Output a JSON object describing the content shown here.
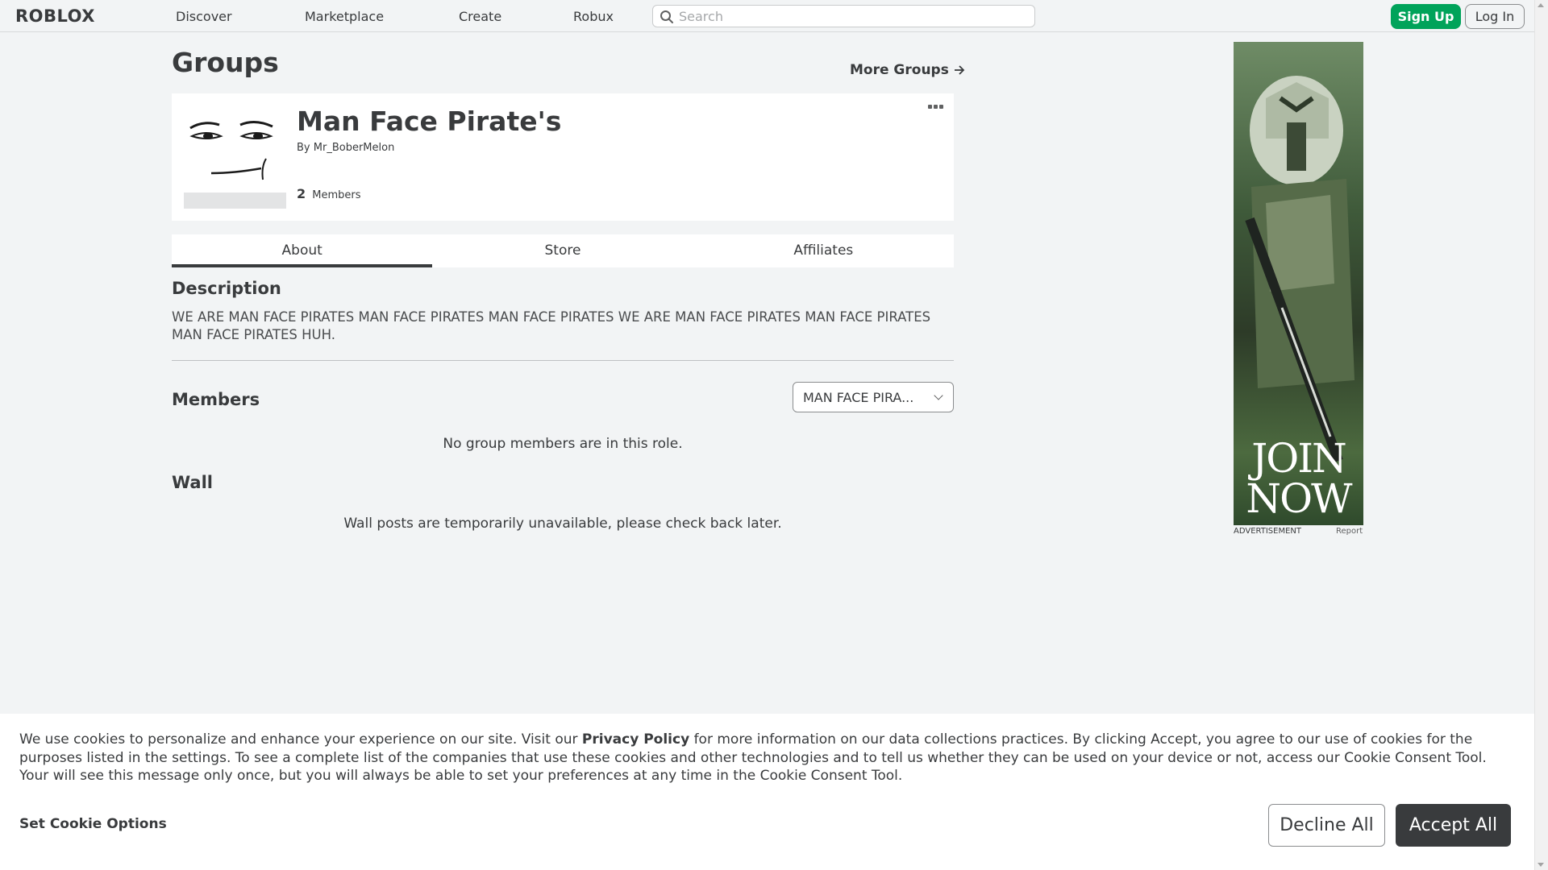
{
  "nav": {
    "logo": "ROBLOX",
    "links": [
      "Discover",
      "Marketplace",
      "Create",
      "Robux"
    ],
    "search_placeholder": "Search",
    "signup": "Sign Up",
    "login": "Log In"
  },
  "page": {
    "title": "Groups",
    "more_groups": "More Groups"
  },
  "group": {
    "name": "Man Face Pirate's",
    "by_prefix": "By",
    "owner": "Mr_BoberMelon",
    "member_count": "2",
    "members_label": "Members"
  },
  "tabs": [
    "About",
    "Store",
    "Affiliates"
  ],
  "about": {
    "description_heading": "Description",
    "description": "WE ARE MAN FACE PIRATES MAN FACE PIRATES MAN FACE PIRATES WE ARE MAN FACE PIRATES MAN FACE PIRATES MAN FACE PIRATES HUH.",
    "members_heading": "Members",
    "role_selected": "MAN FACE PIRA...",
    "no_members": "No group members are in this role.",
    "wall_heading": "Wall",
    "wall_unavailable": "Wall posts are temporarily unavailable, please check back later."
  },
  "ad": {
    "line1": "JOIN",
    "line2": "NOW",
    "label": "ADVERTISEMENT",
    "report": "Report"
  },
  "cookie": {
    "text_before": "We use cookies to personalize and enhance your experience on our site. Visit our ",
    "privacy_link": "Privacy Policy",
    "text_after": " for more information on our data collections practices. By clicking Accept, you agree to our use of cookies for the purposes listed in the settings. To see a complete list of the companies that use these cookies and other technologies and to tell us whether they can be used on your device or not, access our Cookie Consent Tool. Your will see this message only once, but you will always be able to set your preferences at any time in the Cookie Consent Tool.",
    "set_options": "Set Cookie Options",
    "decline": "Decline All",
    "accept": "Accept All"
  },
  "colors": {
    "signup_green": "#00a35a",
    "accept_dark": "#393b3d",
    "page_bg": "#f2f4f5"
  }
}
